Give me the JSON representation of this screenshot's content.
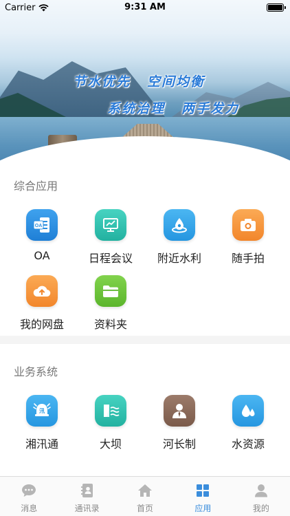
{
  "status_bar": {
    "carrier": "Carrier",
    "time": "9:31 AM"
  },
  "banner": {
    "slogan_line1": [
      "节水优先",
      "空间均衡"
    ],
    "slogan_line2": [
      "系统治理",
      "两手发力"
    ]
  },
  "integrated_apps": {
    "title": "综合应用",
    "items": [
      {
        "label": "OA",
        "icon": "oa-document-icon",
        "color": "#2b8fe0"
      },
      {
        "label": "日程会议",
        "icon": "presentation-chart-icon",
        "color": "#2fc2b0"
      },
      {
        "label": "附近水利",
        "icon": "water-location-icon",
        "color": "#35a6ea"
      },
      {
        "label": "随手拍",
        "icon": "camera-icon",
        "color": "#f7953a"
      },
      {
        "label": "我的网盘",
        "icon": "cloud-upload-icon",
        "color": "#f7953a"
      },
      {
        "label": "资料夹",
        "icon": "folder-icon",
        "color": "#6cc43a"
      }
    ]
  },
  "business_systems": {
    "title": "业务系统",
    "items": [
      {
        "label": "湘汛通",
        "icon": "flood-alarm-icon",
        "color": "#35a6ea"
      },
      {
        "label": "大坝",
        "icon": "dam-icon",
        "color": "#2fc2b0"
      },
      {
        "label": "河长制",
        "icon": "river-chief-person-icon",
        "color": "#8a6a5a"
      },
      {
        "label": "水资源",
        "icon": "water-drops-icon",
        "color": "#35a6ea"
      }
    ]
  },
  "tabbar": {
    "items": [
      {
        "label": "消息",
        "icon": "chat-bubble-icon",
        "active": false
      },
      {
        "label": "通讯录",
        "icon": "contacts-book-icon",
        "active": false
      },
      {
        "label": "首页",
        "icon": "home-icon",
        "active": false
      },
      {
        "label": "应用",
        "icon": "apps-grid-icon",
        "active": true
      },
      {
        "label": "我的",
        "icon": "profile-person-icon",
        "active": false
      }
    ]
  }
}
